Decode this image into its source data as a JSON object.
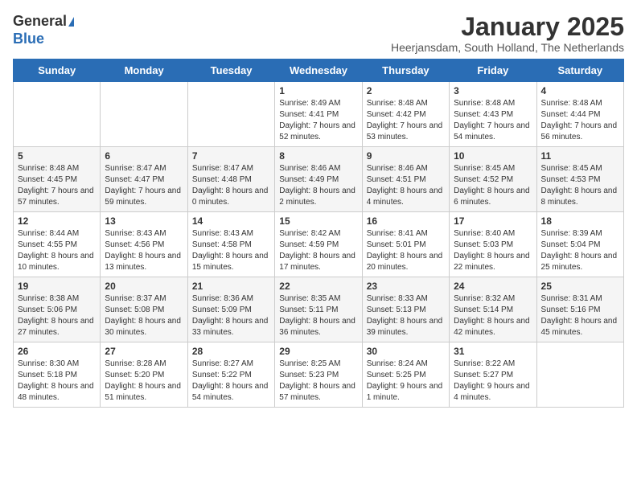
{
  "header": {
    "logo_general": "General",
    "logo_blue": "Blue",
    "month": "January 2025",
    "location": "Heerjansdam, South Holland, The Netherlands"
  },
  "weekdays": [
    "Sunday",
    "Monday",
    "Tuesday",
    "Wednesday",
    "Thursday",
    "Friday",
    "Saturday"
  ],
  "weeks": [
    [
      {
        "day": "",
        "info": ""
      },
      {
        "day": "",
        "info": ""
      },
      {
        "day": "",
        "info": ""
      },
      {
        "day": "1",
        "info": "Sunrise: 8:49 AM\nSunset: 4:41 PM\nDaylight: 7 hours and 52 minutes."
      },
      {
        "day": "2",
        "info": "Sunrise: 8:48 AM\nSunset: 4:42 PM\nDaylight: 7 hours and 53 minutes."
      },
      {
        "day": "3",
        "info": "Sunrise: 8:48 AM\nSunset: 4:43 PM\nDaylight: 7 hours and 54 minutes."
      },
      {
        "day": "4",
        "info": "Sunrise: 8:48 AM\nSunset: 4:44 PM\nDaylight: 7 hours and 56 minutes."
      }
    ],
    [
      {
        "day": "5",
        "info": "Sunrise: 8:48 AM\nSunset: 4:45 PM\nDaylight: 7 hours and 57 minutes."
      },
      {
        "day": "6",
        "info": "Sunrise: 8:47 AM\nSunset: 4:47 PM\nDaylight: 7 hours and 59 minutes."
      },
      {
        "day": "7",
        "info": "Sunrise: 8:47 AM\nSunset: 4:48 PM\nDaylight: 8 hours and 0 minutes."
      },
      {
        "day": "8",
        "info": "Sunrise: 8:46 AM\nSunset: 4:49 PM\nDaylight: 8 hours and 2 minutes."
      },
      {
        "day": "9",
        "info": "Sunrise: 8:46 AM\nSunset: 4:51 PM\nDaylight: 8 hours and 4 minutes."
      },
      {
        "day": "10",
        "info": "Sunrise: 8:45 AM\nSunset: 4:52 PM\nDaylight: 8 hours and 6 minutes."
      },
      {
        "day": "11",
        "info": "Sunrise: 8:45 AM\nSunset: 4:53 PM\nDaylight: 8 hours and 8 minutes."
      }
    ],
    [
      {
        "day": "12",
        "info": "Sunrise: 8:44 AM\nSunset: 4:55 PM\nDaylight: 8 hours and 10 minutes."
      },
      {
        "day": "13",
        "info": "Sunrise: 8:43 AM\nSunset: 4:56 PM\nDaylight: 8 hours and 13 minutes."
      },
      {
        "day": "14",
        "info": "Sunrise: 8:43 AM\nSunset: 4:58 PM\nDaylight: 8 hours and 15 minutes."
      },
      {
        "day": "15",
        "info": "Sunrise: 8:42 AM\nSunset: 4:59 PM\nDaylight: 8 hours and 17 minutes."
      },
      {
        "day": "16",
        "info": "Sunrise: 8:41 AM\nSunset: 5:01 PM\nDaylight: 8 hours and 20 minutes."
      },
      {
        "day": "17",
        "info": "Sunrise: 8:40 AM\nSunset: 5:03 PM\nDaylight: 8 hours and 22 minutes."
      },
      {
        "day": "18",
        "info": "Sunrise: 8:39 AM\nSunset: 5:04 PM\nDaylight: 8 hours and 25 minutes."
      }
    ],
    [
      {
        "day": "19",
        "info": "Sunrise: 8:38 AM\nSunset: 5:06 PM\nDaylight: 8 hours and 27 minutes."
      },
      {
        "day": "20",
        "info": "Sunrise: 8:37 AM\nSunset: 5:08 PM\nDaylight: 8 hours and 30 minutes."
      },
      {
        "day": "21",
        "info": "Sunrise: 8:36 AM\nSunset: 5:09 PM\nDaylight: 8 hours and 33 minutes."
      },
      {
        "day": "22",
        "info": "Sunrise: 8:35 AM\nSunset: 5:11 PM\nDaylight: 8 hours and 36 minutes."
      },
      {
        "day": "23",
        "info": "Sunrise: 8:33 AM\nSunset: 5:13 PM\nDaylight: 8 hours and 39 minutes."
      },
      {
        "day": "24",
        "info": "Sunrise: 8:32 AM\nSunset: 5:14 PM\nDaylight: 8 hours and 42 minutes."
      },
      {
        "day": "25",
        "info": "Sunrise: 8:31 AM\nSunset: 5:16 PM\nDaylight: 8 hours and 45 minutes."
      }
    ],
    [
      {
        "day": "26",
        "info": "Sunrise: 8:30 AM\nSunset: 5:18 PM\nDaylight: 8 hours and 48 minutes."
      },
      {
        "day": "27",
        "info": "Sunrise: 8:28 AM\nSunset: 5:20 PM\nDaylight: 8 hours and 51 minutes."
      },
      {
        "day": "28",
        "info": "Sunrise: 8:27 AM\nSunset: 5:22 PM\nDaylight: 8 hours and 54 minutes."
      },
      {
        "day": "29",
        "info": "Sunrise: 8:25 AM\nSunset: 5:23 PM\nDaylight: 8 hours and 57 minutes."
      },
      {
        "day": "30",
        "info": "Sunrise: 8:24 AM\nSunset: 5:25 PM\nDaylight: 9 hours and 1 minute."
      },
      {
        "day": "31",
        "info": "Sunrise: 8:22 AM\nSunset: 5:27 PM\nDaylight: 9 hours and 4 minutes."
      },
      {
        "day": "",
        "info": ""
      }
    ]
  ]
}
